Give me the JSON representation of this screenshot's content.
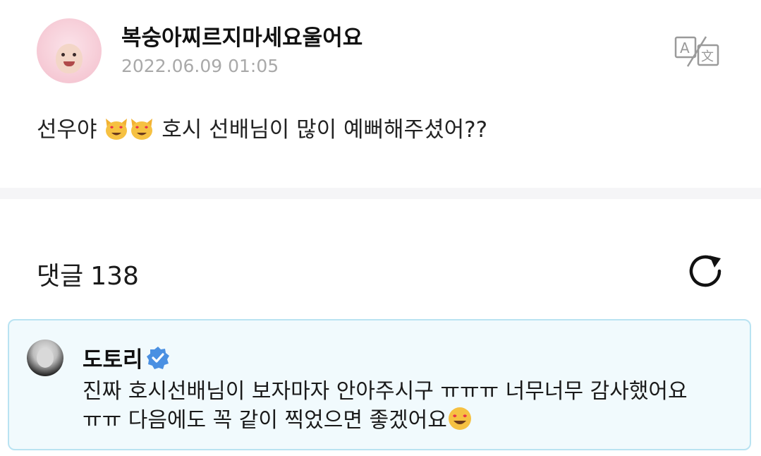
{
  "post": {
    "author": "복숭아찌르지마세요울어요",
    "timestamp": "2022.06.09 01:05",
    "body_prefix": "선우야",
    "body_suffix": "호시 선배님이 많이 예뻐해주셨어??",
    "emojis": [
      "heart-eyes-cat-emoji",
      "heart-eyes-cat-emoji"
    ],
    "translate_icon": "translate-icon"
  },
  "comments": {
    "label": "댓글",
    "count": "138",
    "refresh_icon": "refresh-icon"
  },
  "comment": {
    "author": "도토리",
    "verified_icon": "verified-badge-icon",
    "accent_color": "#b9e3f2",
    "text_line1": "진짜 호시선배님이 보자마자 안아주시구 ㅠㅠㅠ 너무너무 감사했어요",
    "text_line2": "ㅠㅠ 다음에도 꼭 같이 찍었으면 좋겠어요",
    "emoji": "heart-eyes-emoji"
  },
  "colors": {
    "divider": "#f5f5f7",
    "timestamp": "#a9a9a9",
    "verified": "#4a90e2"
  }
}
